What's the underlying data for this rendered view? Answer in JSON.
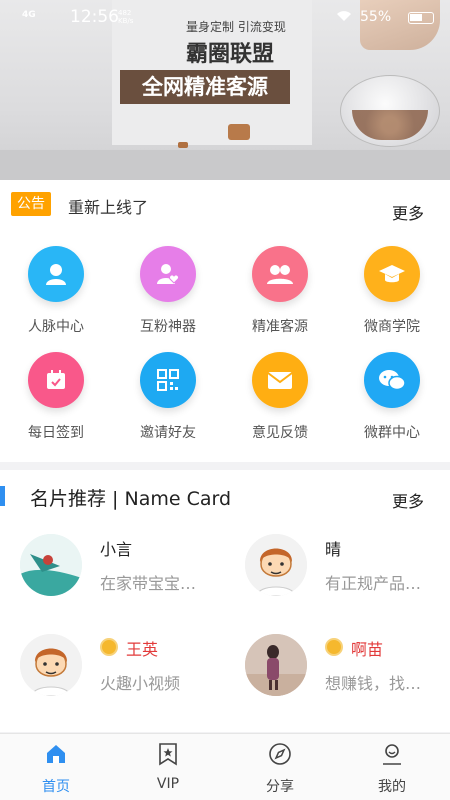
{
  "status_bar": {
    "signal": "4G",
    "time": "12:56",
    "network_speed_value": "482",
    "network_speed_unit": "KB/s",
    "battery": "55%"
  },
  "banner": {
    "tagline": "量身定制 引流变现",
    "brand": "霸圈联盟",
    "slogan": "全网精准客源"
  },
  "notice": {
    "badge": "公告",
    "text": "重新上线了",
    "more": "更多"
  },
  "grid": {
    "items": [
      {
        "label": "人脉中心",
        "icon": "person-icon",
        "color": "#29b6f6"
      },
      {
        "label": "互粉神器",
        "icon": "heart-person-icon",
        "color": "#e67ee8"
      },
      {
        "label": "精准客源",
        "icon": "people-icon",
        "color": "#f9728a"
      },
      {
        "label": "微商学院",
        "icon": "graduation-cap-icon",
        "color": "#ffb11b"
      },
      {
        "label": "每日签到",
        "icon": "calendar-check-icon",
        "color": "#f9588a"
      },
      {
        "label": "邀请好友",
        "icon": "qr-code-icon",
        "color": "#1ea9f2"
      },
      {
        "label": "意见反馈",
        "icon": "mail-icon",
        "color": "#ffae12"
      },
      {
        "label": "微群中心",
        "icon": "wechat-icon",
        "color": "#20a8f4"
      }
    ]
  },
  "cards": {
    "title": "名片推荐 | Name Card",
    "more": "更多",
    "items": [
      {
        "name": "小言",
        "desc": "在家带宝宝…",
        "vip": false
      },
      {
        "name": "晴",
        "desc": "有正规产品…",
        "vip": false
      },
      {
        "name": "王英",
        "desc": "火趣小视频",
        "vip": true
      },
      {
        "name": "啊苗",
        "desc": "想赚钱，找…",
        "vip": true
      }
    ]
  },
  "tabbar": {
    "items": [
      {
        "label": "首页",
        "icon": "home-icon",
        "active": true
      },
      {
        "label": "VIP",
        "icon": "vip-bookmark-icon",
        "active": false
      },
      {
        "label": "分享",
        "icon": "compass-icon",
        "active": false
      },
      {
        "label": "我的",
        "icon": "user-profile-icon",
        "active": false
      }
    ]
  },
  "colors": {
    "accent": "#2f8ff0",
    "notice_badge": "#ffa200",
    "vip_name": "#e23a3a"
  }
}
